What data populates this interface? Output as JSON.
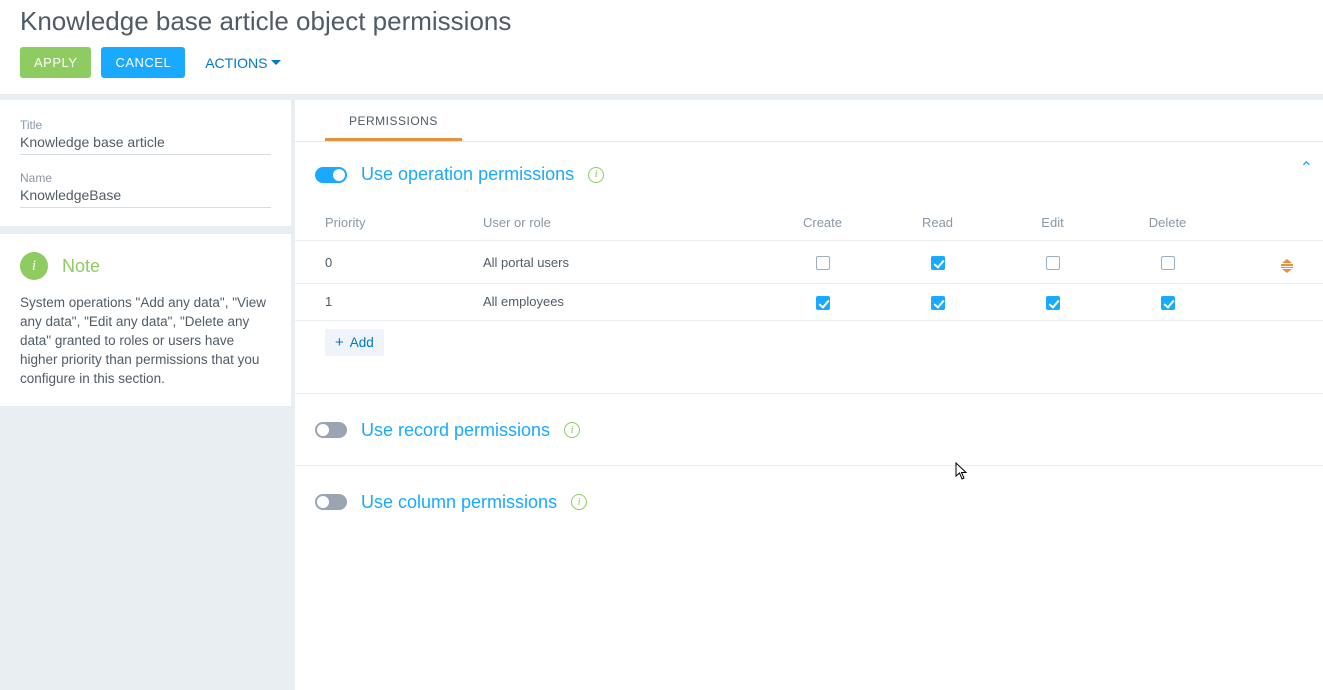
{
  "header": {
    "title": "Knowledge base article object permissions",
    "apply": "APPLY",
    "cancel": "CANCEL",
    "actions": "ACTIONS"
  },
  "sidebar": {
    "titleLabel": "Title",
    "titleValue": "Knowledge base article",
    "nameLabel": "Name",
    "nameValue": "KnowledgeBase",
    "noteTitle": "Note",
    "noteText": "System operations \"Add any data\", \"View any data\", \"Edit any data\", \"Delete any data\" granted to roles or users have higher priority than permissions that you configure in this section."
  },
  "tabs": {
    "permissions": "PERMISSIONS"
  },
  "sections": {
    "op": "Use operation permissions",
    "rec": "Use record permissions",
    "col": "Use column permissions"
  },
  "grid": {
    "cols": {
      "priority": "Priority",
      "user": "User or role",
      "create": "Create",
      "read": "Read",
      "edit": "Edit",
      "delete": "Delete"
    },
    "rows": [
      {
        "priority": "0",
        "user": "All portal users",
        "create": false,
        "read": true,
        "edit": false,
        "delete": false,
        "handle": true
      },
      {
        "priority": "1",
        "user": "All employees",
        "create": true,
        "read": true,
        "edit": true,
        "delete": true,
        "handle": false
      }
    ],
    "add": "Add"
  }
}
